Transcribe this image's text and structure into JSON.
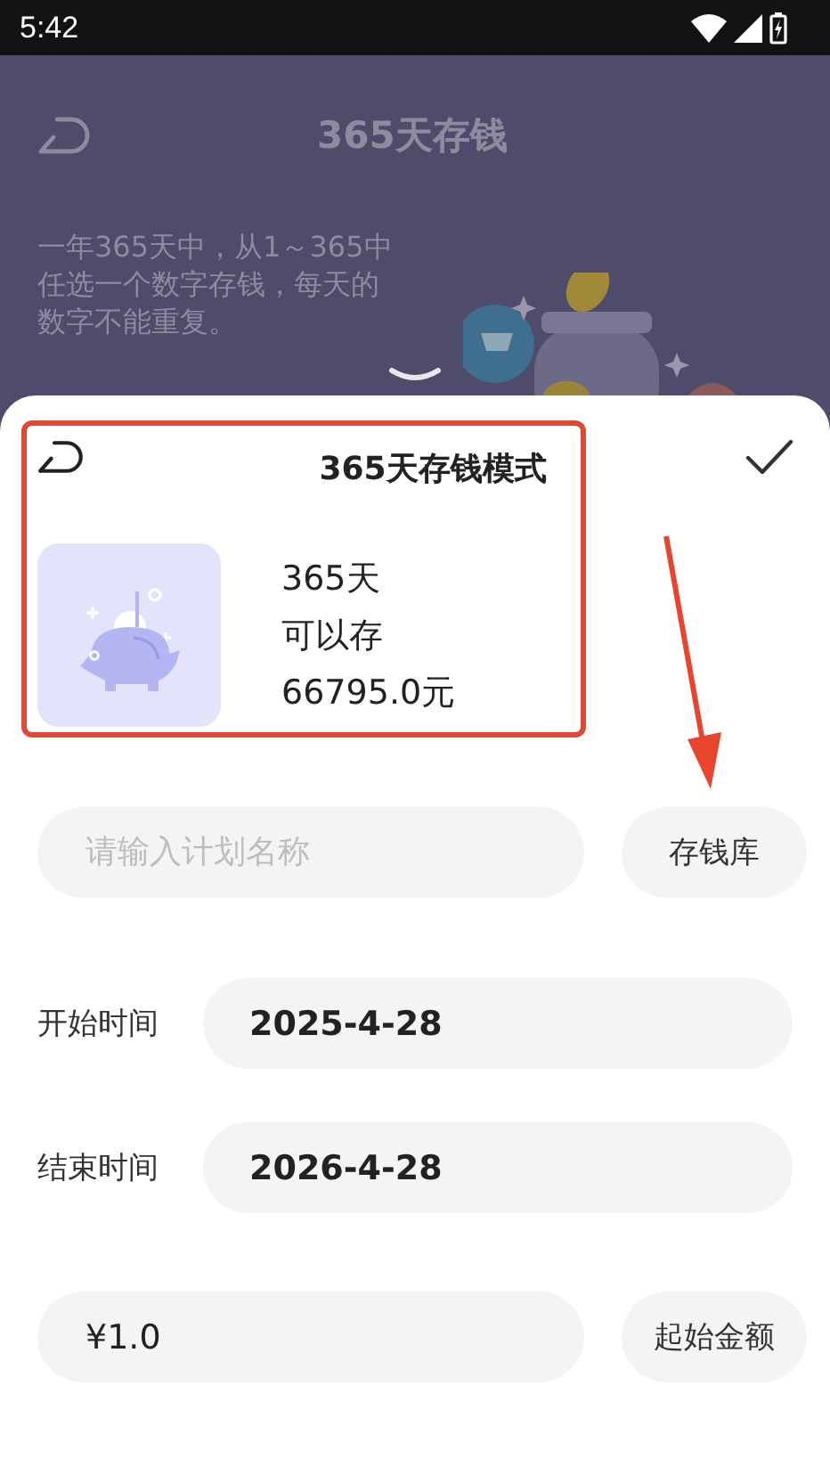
{
  "status_bar": {
    "time": "5:42"
  },
  "background_screen": {
    "title": "365天存钱",
    "description_lines": [
      "一年365天中，从1～365中",
      "任选一个数字存钱，每天的",
      "数字不能重复。"
    ]
  },
  "sheet": {
    "title": "365天存钱模式",
    "mode_card": {
      "lines": [
        "365天",
        "可以存",
        "66795.0元"
      ]
    },
    "plan_name": {
      "placeholder": "请输入计划名称"
    },
    "library_button": "存钱库",
    "dates": [
      {
        "label": "开始时间",
        "value": "2025-4-28"
      },
      {
        "label": "结束时间",
        "value": "2026-4-28"
      }
    ],
    "amount": {
      "value": "¥1.0"
    },
    "amount_button": "起始金额"
  }
}
